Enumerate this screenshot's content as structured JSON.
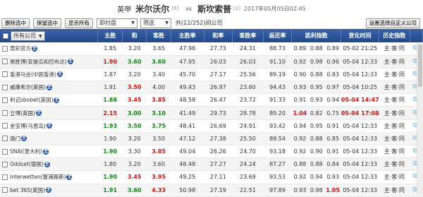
{
  "match": {
    "league": "英甲",
    "home_team": "米尔沃尔",
    "home_rank": "[6]",
    "vs": "vs",
    "away_team": "斯坎索普",
    "away_rank": "[3]",
    "time": "2017年05月05日02:45"
  },
  "toolbar": {
    "delete_selected": "删除选中",
    "keep_selected": "保留选中",
    "show_all": "显示所有",
    "market_select": "即时盘",
    "filter": "筛选",
    "count_text": "共(12/252)间公司",
    "custom_companies": "设置选择自定义公司"
  },
  "columns": {
    "company": "所有公司",
    "home": "主胜",
    "draw": "和",
    "away": "客胜",
    "home_rate": "主胜率",
    "draw_rate": "和率",
    "away_rate": "客胜率",
    "return_rate": "返还率",
    "kelly": "凯利指数",
    "change_time": "变化时间",
    "history": "历史指数"
  },
  "rows": [
    {
      "company": "竞彩官方",
      "home": "1.85",
      "home_class": "",
      "draw": "3.20",
      "draw_class": "",
      "away": "3.65",
      "away_class": "",
      "home_rate": "47.96",
      "draw_rate": "27.73",
      "away_rate": "24.31",
      "return_rate": "88.73",
      "k1": "0.89",
      "k1_class": "",
      "k2": "0.88",
      "k2_class": "",
      "k3": "0.89",
      "k3_class": "",
      "time": "05-02 21:25",
      "time_class": "",
      "history": "主·客·同"
    },
    {
      "company": "易胜博(安提瓜和巴布达)",
      "home": "1.90",
      "home_class": "red",
      "draw": "3.60",
      "draw_class": "green",
      "away": "3.60",
      "away_class": "green",
      "home_rate": "47.95",
      "draw_rate": "26.03",
      "away_rate": "26.03",
      "return_rate": "91.10",
      "k1": "0.92",
      "k1_class": "",
      "k2": "0.98",
      "k2_class": "",
      "k3": "0.96",
      "k3_class": "",
      "time": "05-04 12:33",
      "time_class": "",
      "history": "主·客·同"
    },
    {
      "company": "香港马会(中国香港)",
      "home": "1.87",
      "home_class": "",
      "draw": "3.20",
      "draw_class": "",
      "away": "3.40",
      "away_class": "",
      "home_rate": "45.70",
      "draw_rate": "27.17",
      "away_rate": "25.56",
      "return_rate": "89.19",
      "k1": "0.90",
      "k1_class": "",
      "k2": "0.88",
      "k2_class": "",
      "k3": "0.83",
      "k3_class": "",
      "time": "05-04 12:33",
      "time_class": "",
      "history": "主·客·同"
    },
    {
      "company": "威廉希尔(英国)",
      "home": "1.91",
      "home_class": "",
      "draw": "3.50",
      "draw_class": "red",
      "away": "4.00",
      "away_class": "",
      "home_rate": "49.43",
      "draw_rate": "26.97",
      "away_rate": "23.60",
      "return_rate": "94.43",
      "k1": "0.93",
      "k1_class": "",
      "k2": "0.95",
      "k2_class": "",
      "k3": "0.97",
      "k3_class": "",
      "time": "05-04 10:25",
      "time_class": "",
      "history": "主·客·同"
    },
    {
      "company": "利记sbobet(英国)",
      "home": "1.88",
      "home_class": "green",
      "draw": "3.45",
      "draw_class": "red",
      "away": "3.85",
      "away_class": "red",
      "home_rate": "48.58",
      "draw_rate": "26.47",
      "away_rate": "23.72",
      "return_rate": "91.33",
      "k1": "0.91",
      "k1_class": "",
      "k2": "0.93",
      "k2_class": "",
      "k3": "0.94",
      "k3_class": "",
      "time": "05-04 14:47",
      "time_class": "red",
      "history": "主·客·同"
    },
    {
      "company": "立博(英国)",
      "home": "2.15",
      "home_class": "red",
      "draw": "3.00",
      "draw_class": "green",
      "away": "3.10",
      "away_class": "green",
      "home_rate": "41.49",
      "draw_rate": "29.73",
      "away_rate": "28.78",
      "return_rate": "89.20",
      "k1": "1.04",
      "k1_class": "red",
      "k2": "0.82",
      "k2_class": "",
      "k3": "0.75",
      "k3_class": "",
      "time": "05-04 17:08",
      "time_class": "red",
      "history": "主·客·同"
    },
    {
      "company": "金宝博(马恩岛)",
      "home": "1.93",
      "home_class": "green",
      "draw": "3.50",
      "draw_class": "green",
      "away": "3.75",
      "away_class": "green",
      "home_rate": "48.41",
      "draw_rate": "26.69",
      "away_rate": "24.91",
      "return_rate": "93.42",
      "k1": "0.94",
      "k1_class": "",
      "k2": "0.95",
      "k2_class": "",
      "k3": "0.91",
      "k3_class": "",
      "time": "05-04 12:33",
      "time_class": "",
      "history": "主·客·同"
    },
    {
      "company": "澳门",
      "home": "1.90",
      "home_class": "",
      "draw": "3.20",
      "draw_class": "",
      "away": "3.50",
      "away_class": "",
      "home_rate": "47.12",
      "draw_rate": "27.38",
      "away_rate": "25.50",
      "return_rate": "89.54",
      "k1": "0.92",
      "k1_class": "",
      "k2": "0.88",
      "k2_class": "",
      "k3": "0.85",
      "k3_class": "",
      "time": "05-04 12:33",
      "time_class": "",
      "history": "主·客·同"
    },
    {
      "company": "SNAI(意大利)",
      "home": "1.90",
      "home_class": "green",
      "draw": "3.30",
      "draw_class": "",
      "away": "3.85",
      "away_class": "red",
      "home_rate": "49.04",
      "draw_rate": "26.26",
      "away_rate": "24.70",
      "return_rate": "93.18",
      "k1": "0.92",
      "k1_class": "",
      "k2": "0.90",
      "k2_class": "",
      "k3": "0.91",
      "k3_class": "",
      "time": "05-04 12:33",
      "time_class": "",
      "history": "主·客·同"
    },
    {
      "company": "Oddset(德国)",
      "home": "1.80",
      "home_class": "",
      "draw": "3.20",
      "draw_class": "",
      "away": "3.60",
      "away_class": "",
      "home_rate": "48.48",
      "draw_rate": "27.27",
      "away_rate": "24.24",
      "return_rate": "87.27",
      "k1": "0.88",
      "k1_class": "",
      "k2": "0.88",
      "k2_class": "",
      "k3": "0.84",
      "k3_class": "",
      "time": "05-04 12:33",
      "time_class": "",
      "history": "主·客·同"
    },
    {
      "company": "Interwetten(塞浦路斯)",
      "home": "1.90",
      "home_class": "green",
      "draw": "3.45",
      "draw_class": "red",
      "away": "3.95",
      "away_class": "red",
      "home_rate": "49.25",
      "draw_rate": "27.11",
      "away_rate": "23.69",
      "return_rate": "93.53",
      "k1": "0.92",
      "k1_class": "",
      "k2": "0.94",
      "k2_class": "",
      "k3": "0.93",
      "k3_class": "",
      "time": "05-04 12:33",
      "time_class": "",
      "history": "主·客·同"
    },
    {
      "company": "bet 365(英国)",
      "home": "1.91",
      "home_class": "green",
      "draw": "3.60",
      "draw_class": "green",
      "away": "4.33",
      "away_class": "red",
      "home_rate": "50.98",
      "draw_rate": "27.19",
      "away_rate": "22.51",
      "return_rate": "97.89",
      "k1": "0.93",
      "k1_class": "",
      "k2": "0.98",
      "k2_class": "",
      "k3": "1.05",
      "k3_class": "red",
      "time": "05-04 12:33",
      "time_class": "",
      "history": "主·客·同"
    }
  ],
  "colors": {
    "header_bg": "#24498c",
    "green": "#0a8a0a",
    "red": "#d01010"
  },
  "icons": {
    "pin": "pin-badge-icon",
    "history": "magnifier-icon"
  }
}
